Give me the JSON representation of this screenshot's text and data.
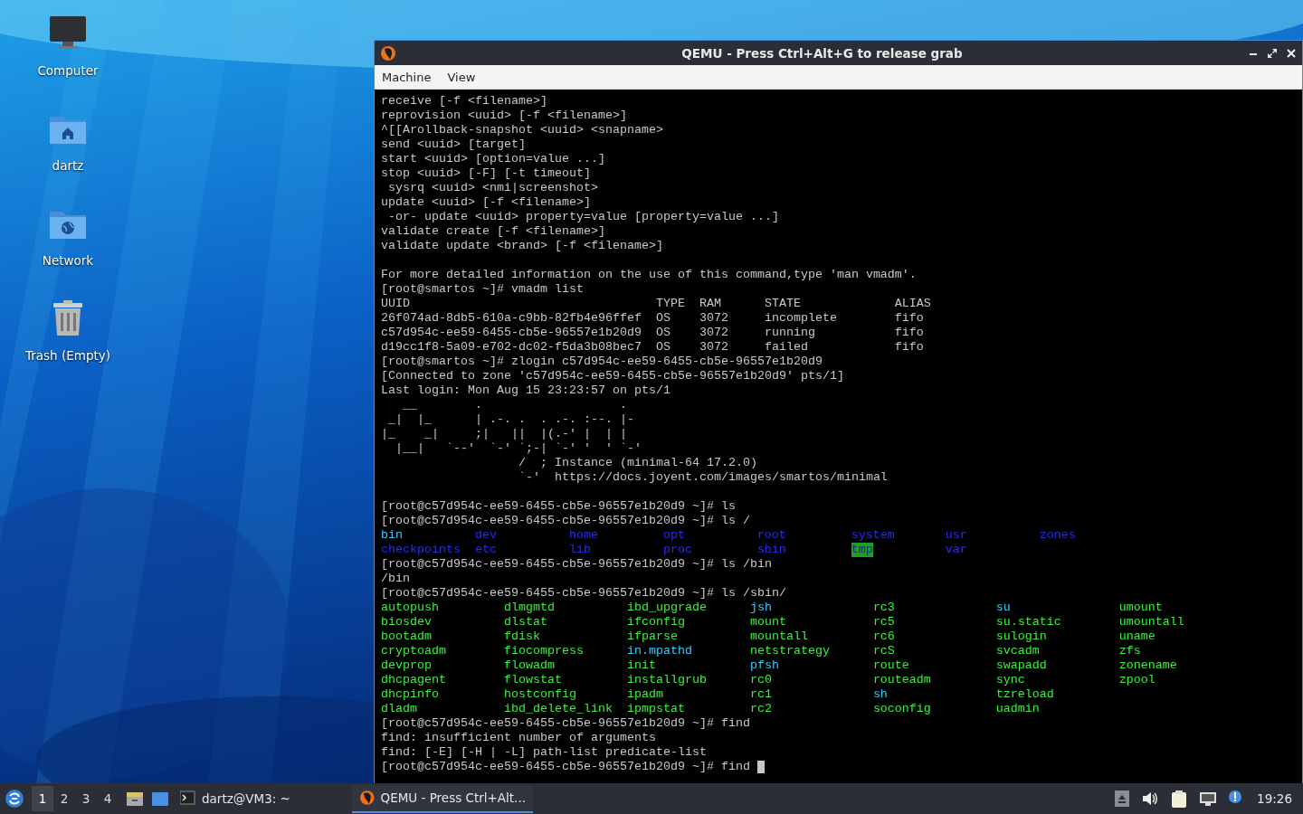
{
  "desktop": {
    "icons": [
      {
        "label": "Computer",
        "kind": "computer"
      },
      {
        "label": "dartz",
        "kind": "home"
      },
      {
        "label": "Network",
        "kind": "network"
      },
      {
        "label": "Trash (Empty)",
        "kind": "trash"
      }
    ]
  },
  "window": {
    "title": "QEMU - Press Ctrl+Alt+G to release grab",
    "menu": [
      "Machine",
      "View"
    ],
    "terminal": {
      "lines": [
        {
          "kind": "text",
          "text": "receive [-f <filename>]"
        },
        {
          "kind": "text",
          "text": "reprovision <uuid> [-f <filename>]"
        },
        {
          "kind": "text",
          "text": "^[[Arollback-snapshot <uuid> <snapname>"
        },
        {
          "kind": "text",
          "text": "send <uuid> [target]"
        },
        {
          "kind": "text",
          "text": "start <uuid> [option=value ...]"
        },
        {
          "kind": "text",
          "text": "stop <uuid> [-F] [-t timeout]"
        },
        {
          "kind": "text",
          "text": " sysrq <uuid> <nmi|screenshot>"
        },
        {
          "kind": "text",
          "text": "update <uuid> [-f <filename>]"
        },
        {
          "kind": "text",
          "text": " -or- update <uuid> property=value [property=value ...]"
        },
        {
          "kind": "text",
          "text": "validate create [-f <filename>]"
        },
        {
          "kind": "text",
          "text": "validate update <brand> [-f <filename>]"
        },
        {
          "kind": "blank"
        },
        {
          "kind": "text",
          "text": "For more detailed information on the use of this command,type 'man vmadm'."
        },
        {
          "kind": "text",
          "text": "[root@smartos ~]# vmadm list"
        },
        {
          "kind": "text",
          "text": "UUID                                  TYPE  RAM      STATE             ALIAS"
        },
        {
          "kind": "text",
          "text": "26f074ad-8db5-610a-c9bb-82fb4e96ffef  OS    3072     incomplete        fifo"
        },
        {
          "kind": "text",
          "text": "c57d954c-ee59-6455-cb5e-96557e1b20d9  OS    3072     running           fifo"
        },
        {
          "kind": "text",
          "text": "d19cc1f8-5a09-e702-dc02-f5da3b08bec7  OS    3072     failed            fifo"
        },
        {
          "kind": "text",
          "text": "[root@smartos ~]# zlogin c57d954c-ee59-6455-cb5e-96557e1b20d9"
        },
        {
          "kind": "text",
          "text": "[Connected to zone 'c57d954c-ee59-6455-cb5e-96557e1b20d9' pts/1]"
        },
        {
          "kind": "text",
          "text": "Last login: Mon Aug 15 23:23:57 on pts/1"
        },
        {
          "kind": "text",
          "text": "   __        .                   ."
        },
        {
          "kind": "text",
          "text": " _|  |_      | .-. .  . .-. :--. |-"
        },
        {
          "kind": "text",
          "text": "|_    _|     ;|   ||  |(.-' |  | |"
        },
        {
          "kind": "text",
          "text": "  |__|   `--'  `-' `;-| `-' '  ' `-'"
        },
        {
          "kind": "text",
          "text": "                   /  ; Instance (minimal-64 17.2.0)"
        },
        {
          "kind": "text",
          "text": "                   `-'  https://docs.joyent.com/images/smartos/minimal"
        },
        {
          "kind": "blank"
        },
        {
          "kind": "text",
          "text": "[root@c57d954c-ee59-6455-cb5e-96557e1b20d9 ~]# ls"
        },
        {
          "kind": "text",
          "text": "[root@c57d954c-ee59-6455-cb5e-96557e1b20d9 ~]# ls /"
        },
        {
          "kind": "listing",
          "rows": [
            [
              {
                "text": "bin",
                "color": "#33ccff",
                "highlighted": false
              },
              {
                "text": "dev",
                "color": "#2b2bf0",
                "highlighted": false
              },
              {
                "text": "home",
                "color": "#2b2bf0",
                "highlighted": false
              },
              {
                "text": "opt",
                "color": "#2b2bf0",
                "highlighted": false
              },
              {
                "text": "root",
                "color": "#2b2bf0",
                "highlighted": false
              },
              {
                "text": "system",
                "color": "#2b2bf0",
                "highlighted": false
              },
              {
                "text": "usr",
                "color": "#2b2bf0",
                "highlighted": false
              },
              {
                "text": "zones",
                "color": "#2b2bf0",
                "highlighted": false
              }
            ],
            [
              {
                "text": "checkpoints",
                "color": "#2b2bf0",
                "highlighted": false
              },
              {
                "text": "etc",
                "color": "#2b2bf0",
                "highlighted": false
              },
              {
                "text": "lib",
                "color": "#2b2bf0",
                "highlighted": false
              },
              {
                "text": "proc",
                "color": "#2b2bf0",
                "highlighted": false
              },
              {
                "text": "sbin",
                "color": "#2b2bf0",
                "highlighted": false
              },
              {
                "text": "tmp",
                "highlighted": true
              },
              {
                "text": "var",
                "color": "#2b2bf0",
                "highlighted": false
              }
            ]
          ]
        },
        {
          "kind": "text",
          "text": "[root@c57d954c-ee59-6455-cb5e-96557e1b20d9 ~]# ls /bin"
        },
        {
          "kind": "text",
          "text": "/bin"
        },
        {
          "kind": "text",
          "text": "[root@c57d954c-ee59-6455-cb5e-96557e1b20d9 ~]# ls /sbin/"
        },
        {
          "kind": "listing",
          "rows": [
            [
              {
                "text": "autopush",
                "color": "#3cf03c",
                "highlighted": false
              },
              {
                "text": "dlmgmtd",
                "color": "#3cf03c",
                "highlighted": false
              },
              {
                "text": "ibd_upgrade",
                "color": "#3cf03c",
                "highlighted": false
              },
              {
                "text": "jsh",
                "color": "#33ccff",
                "highlighted": false
              },
              {
                "text": "rc3",
                "color": "#3cf03c",
                "highlighted": false
              },
              {
                "text": "su",
                "color": "#33ccff",
                "highlighted": false
              },
              {
                "text": "umount",
                "color": "#3cf03c",
                "highlighted": false
              }
            ],
            [
              {
                "text": "biosdev",
                "color": "#3cf03c",
                "highlighted": false
              },
              {
                "text": "dlstat",
                "color": "#3cf03c",
                "highlighted": false
              },
              {
                "text": "ifconfig",
                "color": "#3cf03c",
                "highlighted": false
              },
              {
                "text": "mount",
                "color": "#3cf03c",
                "highlighted": false
              },
              {
                "text": "rc5",
                "color": "#3cf03c",
                "highlighted": false
              },
              {
                "text": "su.static",
                "color": "#3cf03c",
                "highlighted": false
              },
              {
                "text": "umountall",
                "color": "#3cf03c",
                "highlighted": false
              }
            ],
            [
              {
                "text": "bootadm",
                "color": "#3cf03c",
                "highlighted": false
              },
              {
                "text": "fdisk",
                "color": "#3cf03c",
                "highlighted": false
              },
              {
                "text": "ifparse",
                "color": "#3cf03c",
                "highlighted": false
              },
              {
                "text": "mountall",
                "color": "#3cf03c",
                "highlighted": false
              },
              {
                "text": "rc6",
                "color": "#3cf03c",
                "highlighted": false
              },
              {
                "text": "sulogin",
                "color": "#3cf03c",
                "highlighted": false
              },
              {
                "text": "uname",
                "color": "#3cf03c",
                "highlighted": false
              }
            ],
            [
              {
                "text": "cryptoadm",
                "color": "#3cf03c",
                "highlighted": false
              },
              {
                "text": "fiocompress",
                "color": "#3cf03c",
                "highlighted": false
              },
              {
                "text": "in.mpathd",
                "color": "#33ccff",
                "highlighted": false
              },
              {
                "text": "netstrategy",
                "color": "#3cf03c",
                "highlighted": false
              },
              {
                "text": "rcS",
                "color": "#3cf03c",
                "highlighted": false
              },
              {
                "text": "svcadm",
                "color": "#3cf03c",
                "highlighted": false
              },
              {
                "text": "zfs",
                "color": "#3cf03c",
                "highlighted": false
              }
            ],
            [
              {
                "text": "devprop",
                "color": "#3cf03c",
                "highlighted": false
              },
              {
                "text": "flowadm",
                "color": "#3cf03c",
                "highlighted": false
              },
              {
                "text": "init",
                "color": "#3cf03c",
                "highlighted": false
              },
              {
                "text": "pfsh",
                "color": "#33ccff",
                "highlighted": false
              },
              {
                "text": "route",
                "color": "#3cf03c",
                "highlighted": false
              },
              {
                "text": "swapadd",
                "color": "#3cf03c",
                "highlighted": false
              },
              {
                "text": "zonename",
                "color": "#3cf03c",
                "highlighted": false
              }
            ],
            [
              {
                "text": "dhcpagent",
                "color": "#3cf03c",
                "highlighted": false
              },
              {
                "text": "flowstat",
                "color": "#3cf03c",
                "highlighted": false
              },
              {
                "text": "installgrub",
                "color": "#3cf03c",
                "highlighted": false
              },
              {
                "text": "rc0",
                "color": "#3cf03c",
                "highlighted": false
              },
              {
                "text": "routeadm",
                "color": "#3cf03c",
                "highlighted": false
              },
              {
                "text": "sync",
                "color": "#3cf03c",
                "highlighted": false
              },
              {
                "text": "zpool",
                "color": "#3cf03c",
                "highlighted": false
              }
            ],
            [
              {
                "text": "dhcpinfo",
                "color": "#3cf03c",
                "highlighted": false
              },
              {
                "text": "hostconfig",
                "color": "#3cf03c",
                "highlighted": false
              },
              {
                "text": "ipadm",
                "color": "#3cf03c",
                "highlighted": false
              },
              {
                "text": "rc1",
                "color": "#3cf03c",
                "highlighted": false
              },
              {
                "text": "sh",
                "color": "#33ccff",
                "highlighted": false
              },
              {
                "text": "tzreload",
                "color": "#3cf03c",
                "highlighted": false
              }
            ],
            [
              {
                "text": "dladm",
                "color": "#3cf03c",
                "highlighted": false
              },
              {
                "text": "ibd_delete_link",
                "color": "#3cf03c",
                "highlighted": false
              },
              {
                "text": "ipmpstat",
                "color": "#3cf03c",
                "highlighted": false
              },
              {
                "text": "rc2",
                "color": "#3cf03c",
                "highlighted": false
              },
              {
                "text": "soconfig",
                "color": "#3cf03c",
                "highlighted": false
              },
              {
                "text": "uadmin",
                "color": "#3cf03c",
                "highlighted": false
              }
            ]
          ]
        },
        {
          "kind": "text",
          "text": "[root@c57d954c-ee59-6455-cb5e-96557e1b20d9 ~]# find"
        },
        {
          "kind": "text",
          "text": "find: insufficient number of arguments"
        },
        {
          "kind": "text",
          "text": "find: [-E] [-H | -L] path-list predicate-list"
        },
        {
          "kind": "prompt",
          "text": "[root@c57d954c-ee59-6455-cb5e-96557e1b20d9 ~]# find",
          "cursor": true
        }
      ]
    }
  },
  "taskbar": {
    "workspaces": [
      {
        "label": "1",
        "selected": true
      },
      {
        "label": "2",
        "selected": false
      },
      {
        "label": "3",
        "selected": false
      },
      {
        "label": "4",
        "selected": false
      }
    ],
    "launchers": [
      {
        "kind": "files"
      },
      {
        "kind": "desktop"
      }
    ],
    "tasks": [
      {
        "label": "dartz@VM3: ~",
        "kind": "terminal",
        "selected": false
      },
      {
        "label": "QEMU - Press Ctrl+Alt...",
        "kind": "qemu",
        "selected": true
      }
    ],
    "tray": [
      {
        "kind": "updates"
      },
      {
        "kind": "volume"
      },
      {
        "kind": "clipboard"
      },
      {
        "kind": "network"
      },
      {
        "kind": "notice"
      }
    ],
    "clock": "19:26"
  }
}
